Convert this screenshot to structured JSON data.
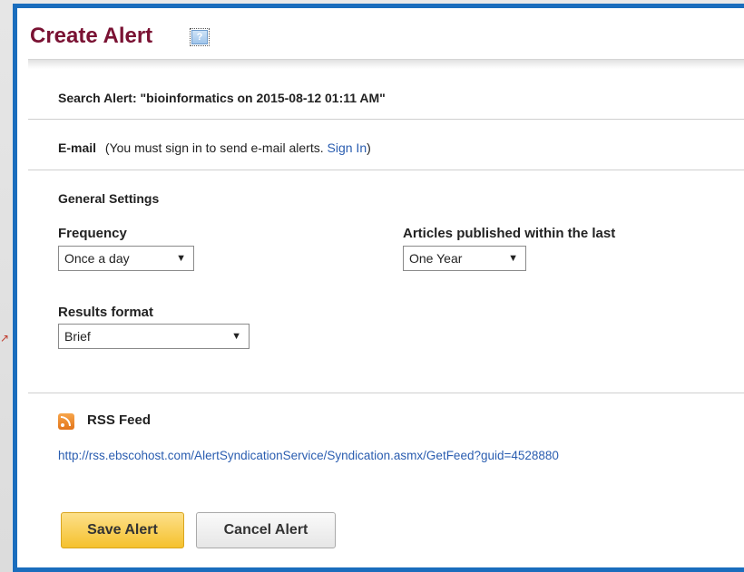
{
  "header": {
    "title": "Create Alert",
    "help_glyph": "?"
  },
  "search_alert": {
    "text": "Search Alert: \"bioinformatics on 2015-08-12 01:11 AM\""
  },
  "email": {
    "label": "E-mail",
    "note_prefix": "(You must sign in to send e-mail alerts.",
    "sign_in": "Sign In",
    "note_suffix": ")"
  },
  "general": {
    "heading": "General Settings",
    "frequency_label": "Frequency",
    "frequency_value": "Once a day",
    "articles_label": "Articles published within the last",
    "articles_value": "One Year",
    "results_label": "Results format",
    "results_value": "Brief"
  },
  "rss": {
    "label": "RSS Feed",
    "url": "http://rss.ebscohost.com/AlertSyndicationService/Syndication.asmx/GetFeed?guid=4528880"
  },
  "actions": {
    "save": "Save Alert",
    "cancel": "Cancel Alert"
  },
  "icons": {
    "help": "help-icon",
    "rss": "rss-icon",
    "dropdown": "chevron-down-icon"
  },
  "colors": {
    "title": "#7a1233",
    "frame": "#1a6dbd",
    "link": "#2a5db0",
    "save_button": "#f5c12d"
  }
}
